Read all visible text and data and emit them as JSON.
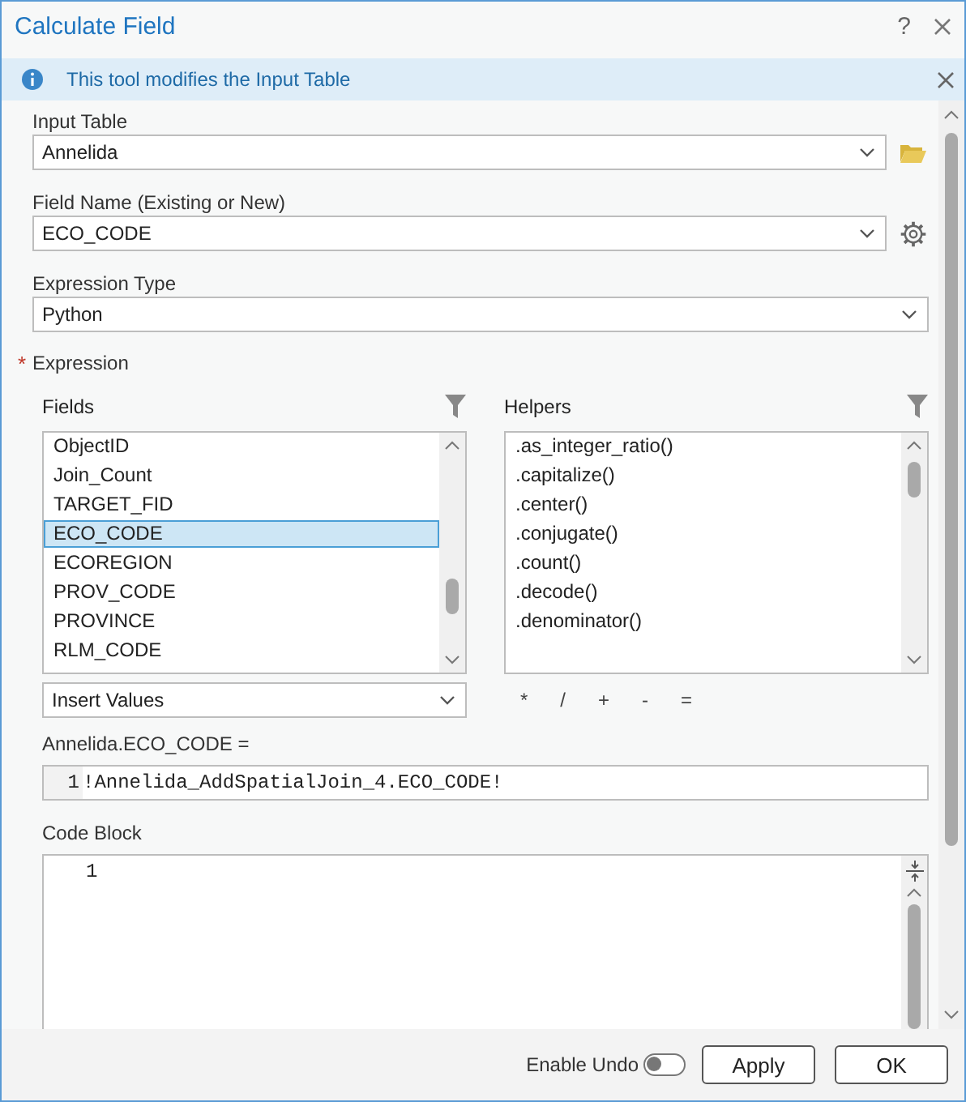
{
  "window": {
    "title": "Calculate Field",
    "help": "?"
  },
  "info_bar": {
    "message": "This tool modifies the Input Table"
  },
  "input_table": {
    "label": "Input Table",
    "value": "Annelida"
  },
  "field_name": {
    "label": "Field Name (Existing or New)",
    "value": "ECO_CODE"
  },
  "expression_type": {
    "label": "Expression Type",
    "value": "Python"
  },
  "expression": {
    "required_mark": "*",
    "label": "Expression",
    "fields": {
      "label": "Fields",
      "items": [
        {
          "label": "ObjectID",
          "selected": false
        },
        {
          "label": "Join_Count",
          "selected": false
        },
        {
          "label": "TARGET_FID",
          "selected": false
        },
        {
          "label": "ECO_CODE",
          "selected": true
        },
        {
          "label": "ECOREGION",
          "selected": false
        },
        {
          "label": "PROV_CODE",
          "selected": false
        },
        {
          "label": "PROVINCE",
          "selected": false
        },
        {
          "label": "RLM_CODE",
          "selected": false
        }
      ]
    },
    "helpers": {
      "label": "Helpers",
      "items": [
        {
          "label": ".as_integer_ratio()",
          "selected": false
        },
        {
          "label": ".capitalize()",
          "selected": false
        },
        {
          "label": ".center()",
          "selected": false
        },
        {
          "label": ".conjugate()",
          "selected": false
        },
        {
          "label": ".count()",
          "selected": false
        },
        {
          "label": ".decode()",
          "selected": false
        },
        {
          "label": ".denominator()",
          "selected": false
        }
      ]
    },
    "insert_values": "Insert Values",
    "operators": [
      "*",
      "/",
      "+",
      "-",
      "="
    ],
    "target": "Annelida.ECO_CODE =",
    "code_lines": [
      {
        "number": "1",
        "text": "!Annelida_AddSpatialJoin_4.ECO_CODE!"
      }
    ]
  },
  "code_block": {
    "label": "Code Block",
    "line_numbers": [
      "1"
    ]
  },
  "footer": {
    "enable_undo": {
      "label": "Enable Undo",
      "on": false
    },
    "buttons": [
      "Apply",
      "OK"
    ]
  }
}
